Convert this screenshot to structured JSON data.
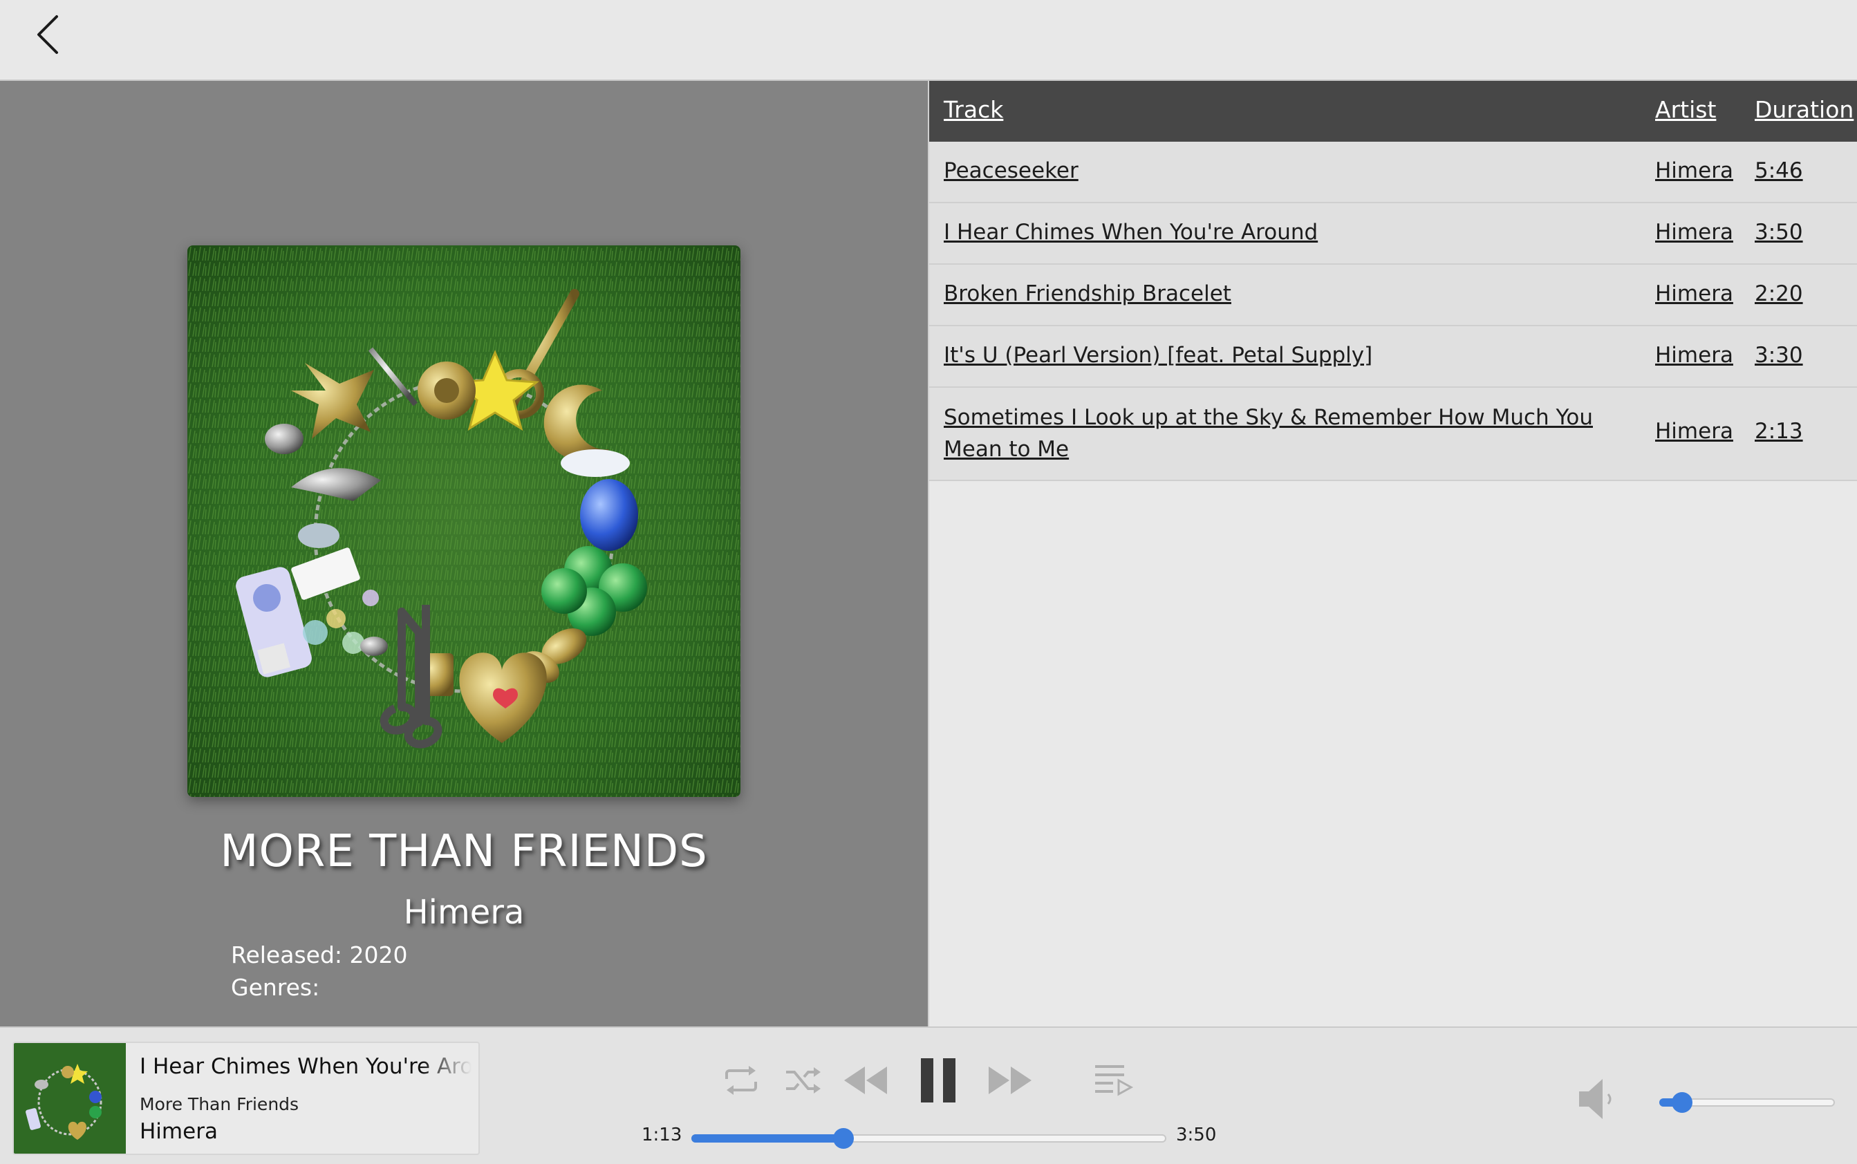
{
  "album": {
    "title": "MORE THAN FRIENDS",
    "artist": "Himera",
    "released": "Released: 2020",
    "genres": "Genres:"
  },
  "tracklist": {
    "headers": {
      "track": "Track",
      "artist": "Artist",
      "duration": "Duration"
    },
    "tracks": [
      {
        "title": "Peaceseeker",
        "artist": "Himera",
        "duration": "5:46"
      },
      {
        "title": "I Hear Chimes When You're Around",
        "artist": "Himera",
        "duration": "3:50"
      },
      {
        "title": "Broken Friendship Bracelet",
        "artist": "Himera",
        "duration": "2:20"
      },
      {
        "title": "It's U (Pearl Version) [feat. Petal Supply]",
        "artist": "Himera",
        "duration": "3:30"
      },
      {
        "title": "Sometimes I Look up at the Sky & Remember How Much You Mean to Me",
        "artist": "Himera",
        "duration": "2:13"
      }
    ]
  },
  "player": {
    "now_playing": {
      "title": "I Hear Chimes When You're Around",
      "album": "More Than Friends",
      "artist": "Himera"
    },
    "elapsed": "1:13",
    "total": "3:50",
    "progress_fraction": 0.32,
    "volume_fraction": 0.13,
    "state": "playing"
  },
  "icons": {
    "back": "chevron-left-icon",
    "repeat": "repeat-icon",
    "shuffle": "shuffle-icon",
    "previous": "rewind-icon",
    "pause": "pause-icon",
    "next": "fast-forward-icon",
    "queue": "queue-icon",
    "volume": "speaker-icon"
  },
  "colors": {
    "accent": "#3b7ddd",
    "header_bg": "#474747",
    "album_panel_bg": "#838383"
  }
}
